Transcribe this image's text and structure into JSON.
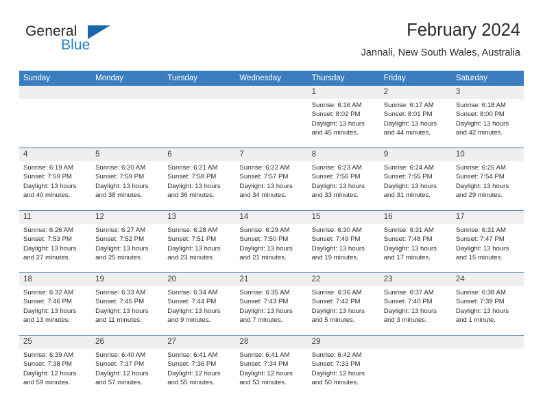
{
  "brand": {
    "name_part1": "General",
    "name_part2": "Blue",
    "triangle_color": "#1668ab",
    "blue_color": "#1f7fc4"
  },
  "header": {
    "title": "February 2024",
    "subtitle": "Jannali, New South Wales, Australia"
  },
  "theme": {
    "header_blue": "#3a7ebf",
    "week_divider": "#2f72b4",
    "daynum_band": "#efefef"
  },
  "weekday_headers": [
    "Sunday",
    "Monday",
    "Tuesday",
    "Wednesday",
    "Thursday",
    "Friday",
    "Saturday"
  ],
  "labels": {
    "sunrise_prefix": "Sunrise:",
    "sunset_prefix": "Sunset:",
    "daylight_prefix": "Daylight:"
  },
  "weeks": [
    [
      {
        "day": "",
        "sunrise": "",
        "sunset": "",
        "daylight_line1": "",
        "daylight_line2": ""
      },
      {
        "day": "",
        "sunrise": "",
        "sunset": "",
        "daylight_line1": "",
        "daylight_line2": ""
      },
      {
        "day": "",
        "sunrise": "",
        "sunset": "",
        "daylight_line1": "",
        "daylight_line2": ""
      },
      {
        "day": "",
        "sunrise": "",
        "sunset": "",
        "daylight_line1": "",
        "daylight_line2": ""
      },
      {
        "day": "1",
        "sunrise": "Sunrise: 6:16 AM",
        "sunset": "Sunset: 8:02 PM",
        "daylight_line1": "Daylight: 13 hours",
        "daylight_line2": "and 45 minutes."
      },
      {
        "day": "2",
        "sunrise": "Sunrise: 6:17 AM",
        "sunset": "Sunset: 8:01 PM",
        "daylight_line1": "Daylight: 13 hours",
        "daylight_line2": "and 44 minutes."
      },
      {
        "day": "3",
        "sunrise": "Sunrise: 6:18 AM",
        "sunset": "Sunset: 8:00 PM",
        "daylight_line1": "Daylight: 13 hours",
        "daylight_line2": "and 42 minutes."
      }
    ],
    [
      {
        "day": "4",
        "sunrise": "Sunrise: 6:19 AM",
        "sunset": "Sunset: 7:59 PM",
        "daylight_line1": "Daylight: 13 hours",
        "daylight_line2": "and 40 minutes."
      },
      {
        "day": "5",
        "sunrise": "Sunrise: 6:20 AM",
        "sunset": "Sunset: 7:59 PM",
        "daylight_line1": "Daylight: 13 hours",
        "daylight_line2": "and 38 minutes."
      },
      {
        "day": "6",
        "sunrise": "Sunrise: 6:21 AM",
        "sunset": "Sunset: 7:58 PM",
        "daylight_line1": "Daylight: 13 hours",
        "daylight_line2": "and 36 minutes."
      },
      {
        "day": "7",
        "sunrise": "Sunrise: 6:22 AM",
        "sunset": "Sunset: 7:57 PM",
        "daylight_line1": "Daylight: 13 hours",
        "daylight_line2": "and 34 minutes."
      },
      {
        "day": "8",
        "sunrise": "Sunrise: 6:23 AM",
        "sunset": "Sunset: 7:56 PM",
        "daylight_line1": "Daylight: 13 hours",
        "daylight_line2": "and 33 minutes."
      },
      {
        "day": "9",
        "sunrise": "Sunrise: 6:24 AM",
        "sunset": "Sunset: 7:55 PM",
        "daylight_line1": "Daylight: 13 hours",
        "daylight_line2": "and 31 minutes."
      },
      {
        "day": "10",
        "sunrise": "Sunrise: 6:25 AM",
        "sunset": "Sunset: 7:54 PM",
        "daylight_line1": "Daylight: 13 hours",
        "daylight_line2": "and 29 minutes."
      }
    ],
    [
      {
        "day": "11",
        "sunrise": "Sunrise: 6:26 AM",
        "sunset": "Sunset: 7:53 PM",
        "daylight_line1": "Daylight: 13 hours",
        "daylight_line2": "and 27 minutes."
      },
      {
        "day": "12",
        "sunrise": "Sunrise: 6:27 AM",
        "sunset": "Sunset: 7:52 PM",
        "daylight_line1": "Daylight: 13 hours",
        "daylight_line2": "and 25 minutes."
      },
      {
        "day": "13",
        "sunrise": "Sunrise: 6:28 AM",
        "sunset": "Sunset: 7:51 PM",
        "daylight_line1": "Daylight: 13 hours",
        "daylight_line2": "and 23 minutes."
      },
      {
        "day": "14",
        "sunrise": "Sunrise: 6:29 AM",
        "sunset": "Sunset: 7:50 PM",
        "daylight_line1": "Daylight: 13 hours",
        "daylight_line2": "and 21 minutes."
      },
      {
        "day": "15",
        "sunrise": "Sunrise: 6:30 AM",
        "sunset": "Sunset: 7:49 PM",
        "daylight_line1": "Daylight: 13 hours",
        "daylight_line2": "and 19 minutes."
      },
      {
        "day": "16",
        "sunrise": "Sunrise: 6:31 AM",
        "sunset": "Sunset: 7:48 PM",
        "daylight_line1": "Daylight: 13 hours",
        "daylight_line2": "and 17 minutes."
      },
      {
        "day": "17",
        "sunrise": "Sunrise: 6:31 AM",
        "sunset": "Sunset: 7:47 PM",
        "daylight_line1": "Daylight: 13 hours",
        "daylight_line2": "and 15 minutes."
      }
    ],
    [
      {
        "day": "18",
        "sunrise": "Sunrise: 6:32 AM",
        "sunset": "Sunset: 7:46 PM",
        "daylight_line1": "Daylight: 13 hours",
        "daylight_line2": "and 13 minutes."
      },
      {
        "day": "19",
        "sunrise": "Sunrise: 6:33 AM",
        "sunset": "Sunset: 7:45 PM",
        "daylight_line1": "Daylight: 13 hours",
        "daylight_line2": "and 11 minutes."
      },
      {
        "day": "20",
        "sunrise": "Sunrise: 6:34 AM",
        "sunset": "Sunset: 7:44 PM",
        "daylight_line1": "Daylight: 13 hours",
        "daylight_line2": "and 9 minutes."
      },
      {
        "day": "21",
        "sunrise": "Sunrise: 6:35 AM",
        "sunset": "Sunset: 7:43 PM",
        "daylight_line1": "Daylight: 13 hours",
        "daylight_line2": "and 7 minutes."
      },
      {
        "day": "22",
        "sunrise": "Sunrise: 6:36 AM",
        "sunset": "Sunset: 7:42 PM",
        "daylight_line1": "Daylight: 13 hours",
        "daylight_line2": "and 5 minutes."
      },
      {
        "day": "23",
        "sunrise": "Sunrise: 6:37 AM",
        "sunset": "Sunset: 7:40 PM",
        "daylight_line1": "Daylight: 13 hours",
        "daylight_line2": "and 3 minutes."
      },
      {
        "day": "24",
        "sunrise": "Sunrise: 6:38 AM",
        "sunset": "Sunset: 7:39 PM",
        "daylight_line1": "Daylight: 13 hours",
        "daylight_line2": "and 1 minute."
      }
    ],
    [
      {
        "day": "25",
        "sunrise": "Sunrise: 6:39 AM",
        "sunset": "Sunset: 7:38 PM",
        "daylight_line1": "Daylight: 12 hours",
        "daylight_line2": "and 59 minutes."
      },
      {
        "day": "26",
        "sunrise": "Sunrise: 6:40 AM",
        "sunset": "Sunset: 7:37 PM",
        "daylight_line1": "Daylight: 12 hours",
        "daylight_line2": "and 57 minutes."
      },
      {
        "day": "27",
        "sunrise": "Sunrise: 6:41 AM",
        "sunset": "Sunset: 7:36 PM",
        "daylight_line1": "Daylight: 12 hours",
        "daylight_line2": "and 55 minutes."
      },
      {
        "day": "28",
        "sunrise": "Sunrise: 6:41 AM",
        "sunset": "Sunset: 7:34 PM",
        "daylight_line1": "Daylight: 12 hours",
        "daylight_line2": "and 53 minutes."
      },
      {
        "day": "29",
        "sunrise": "Sunrise: 6:42 AM",
        "sunset": "Sunset: 7:33 PM",
        "daylight_line1": "Daylight: 12 hours",
        "daylight_line2": "and 50 minutes."
      },
      {
        "day": "",
        "sunrise": "",
        "sunset": "",
        "daylight_line1": "",
        "daylight_line2": ""
      },
      {
        "day": "",
        "sunrise": "",
        "sunset": "",
        "daylight_line1": "",
        "daylight_line2": ""
      }
    ]
  ]
}
